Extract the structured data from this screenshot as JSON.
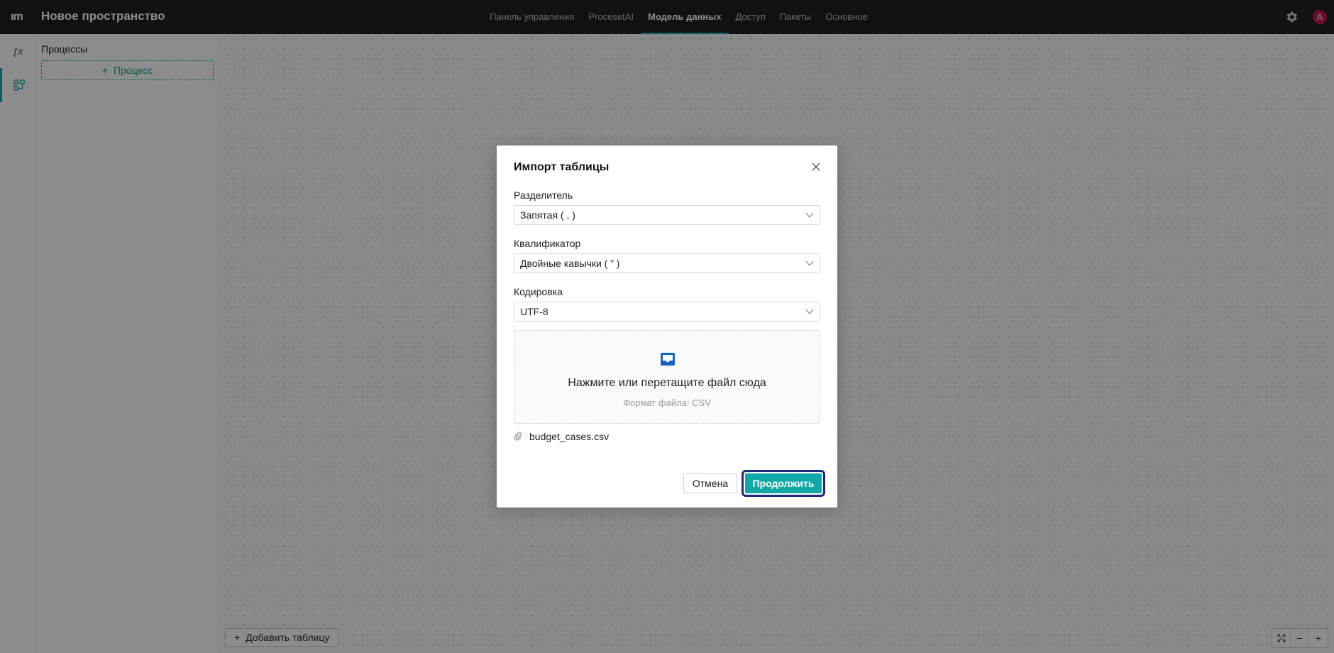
{
  "app": {
    "logo": "ım",
    "title": "Новое пространство"
  },
  "nav": {
    "tabs": [
      {
        "label": "Панель управления"
      },
      {
        "label": "ProcesetAI"
      },
      {
        "label": "Модель данных",
        "active": true
      },
      {
        "label": "Доступ"
      },
      {
        "label": "Пакеты"
      },
      {
        "label": "Основное"
      }
    ]
  },
  "user": {
    "avatar_letter": "A",
    "avatar_color": "#c2185b"
  },
  "rail": {
    "function_icon_label": "ƒx"
  },
  "panel": {
    "title": "Процессы",
    "add_process_label": "Процесс"
  },
  "canvas": {
    "add_table_label": "Добавить таблицу"
  },
  "modal": {
    "title": "Импорт таблицы",
    "separator": {
      "label": "Разделитель",
      "value": "Запятая ( , )"
    },
    "qualifier": {
      "label": "Квалификатор",
      "value": "Двойные кавычки ( ” )"
    },
    "encoding": {
      "label": "Кодировка",
      "value": "UTF-8"
    },
    "dropzone": {
      "text": "Нажмите или перетащите файл сюда",
      "hint": "Формат файла: CSV"
    },
    "file": {
      "name": "budget_cases.csv"
    },
    "cancel_label": "Отмена",
    "continue_label": "Продолжить"
  },
  "colors": {
    "accent": "#1aa9a5",
    "primary_button": "#13a8a8",
    "focus_ring": "#1d2b7a",
    "topbar": "#1f1f1f"
  }
}
